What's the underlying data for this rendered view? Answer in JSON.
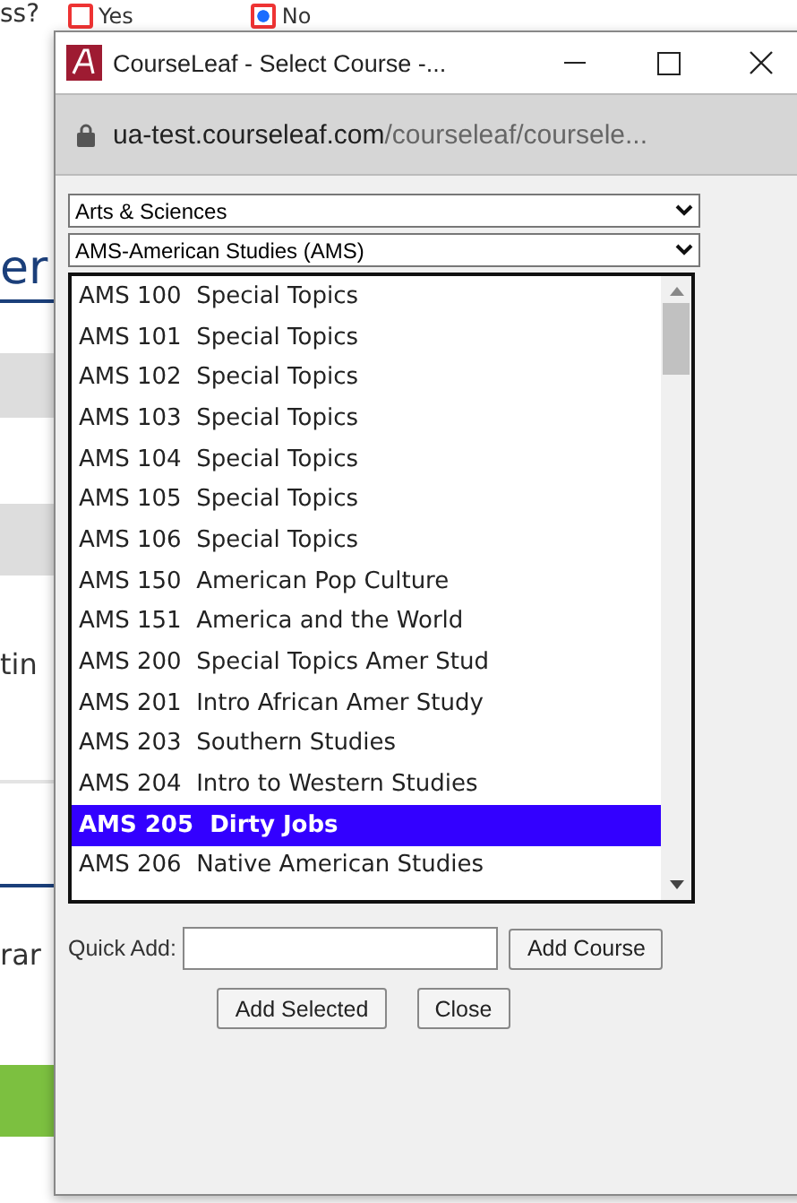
{
  "background": {
    "question": "ss?",
    "radios": [
      {
        "label": "Yes",
        "selected": false
      },
      {
        "label": "No",
        "selected": true
      }
    ],
    "heading": "er",
    "labels": [
      "tin",
      "rar"
    ]
  },
  "window": {
    "title": "CourseLeaf - Select Course -...",
    "url_domain": "ua-test.courseleaf.com",
    "url_path": "/courseleaf/coursele..."
  },
  "college_select": "Arts & Sciences",
  "subject_select": "AMS-American Studies (AMS)",
  "courses": [
    {
      "code": "AMS 100",
      "title": "Special Topics",
      "selected": false
    },
    {
      "code": "AMS 101",
      "title": "Special Topics",
      "selected": false
    },
    {
      "code": "AMS 102",
      "title": "Special Topics",
      "selected": false
    },
    {
      "code": "AMS 103",
      "title": "Special Topics",
      "selected": false
    },
    {
      "code": "AMS 104",
      "title": "Special Topics",
      "selected": false
    },
    {
      "code": "AMS 105",
      "title": "Special Topics",
      "selected": false
    },
    {
      "code": "AMS 106",
      "title": "Special Topics",
      "selected": false
    },
    {
      "code": "AMS 150",
      "title": "American Pop Culture",
      "selected": false
    },
    {
      "code": "AMS 151",
      "title": "America and the World",
      "selected": false
    },
    {
      "code": "AMS 200",
      "title": "Special Topics Amer Stud",
      "selected": false
    },
    {
      "code": "AMS 201",
      "title": "Intro African Amer Study",
      "selected": false
    },
    {
      "code": "AMS 203",
      "title": "Southern Studies",
      "selected": false
    },
    {
      "code": "AMS 204",
      "title": "Intro to Western Studies",
      "selected": false
    },
    {
      "code": "AMS 205",
      "title": "Dirty Jobs",
      "selected": true
    },
    {
      "code": "AMS 206",
      "title": "Native American Studies",
      "selected": false
    }
  ],
  "quick_add": {
    "label": "Quick Add:",
    "button": "Add Course"
  },
  "buttons": [
    "Add Selected",
    "Close"
  ]
}
